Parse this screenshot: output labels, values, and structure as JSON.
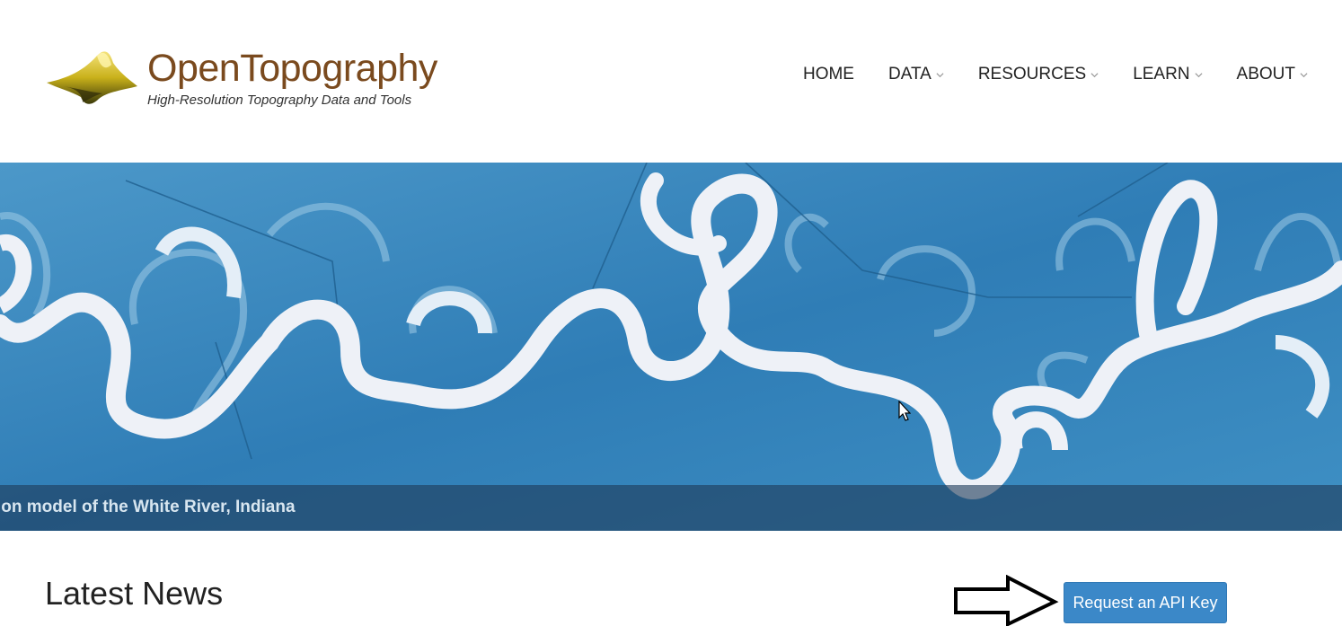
{
  "brand": {
    "title": "OpenTopography",
    "subtitle": "High-Resolution Topography Data and Tools",
    "logo_icon": "mountain-logo-icon"
  },
  "nav": {
    "items": [
      {
        "label": "HOME",
        "dropdown": false
      },
      {
        "label": "DATA",
        "dropdown": true
      },
      {
        "label": "RESOURCES",
        "dropdown": true
      },
      {
        "label": "LEARN",
        "dropdown": true
      },
      {
        "label": "ABOUT",
        "dropdown": true
      }
    ]
  },
  "hero": {
    "caption": "ion model of the White River, Indiana"
  },
  "main": {
    "news_title": "Latest News",
    "api_button": "Request an API Key"
  },
  "colors": {
    "brand": "#7a4a1e",
    "hero_blue": "#3a87bd",
    "button": "#3b88c8"
  }
}
